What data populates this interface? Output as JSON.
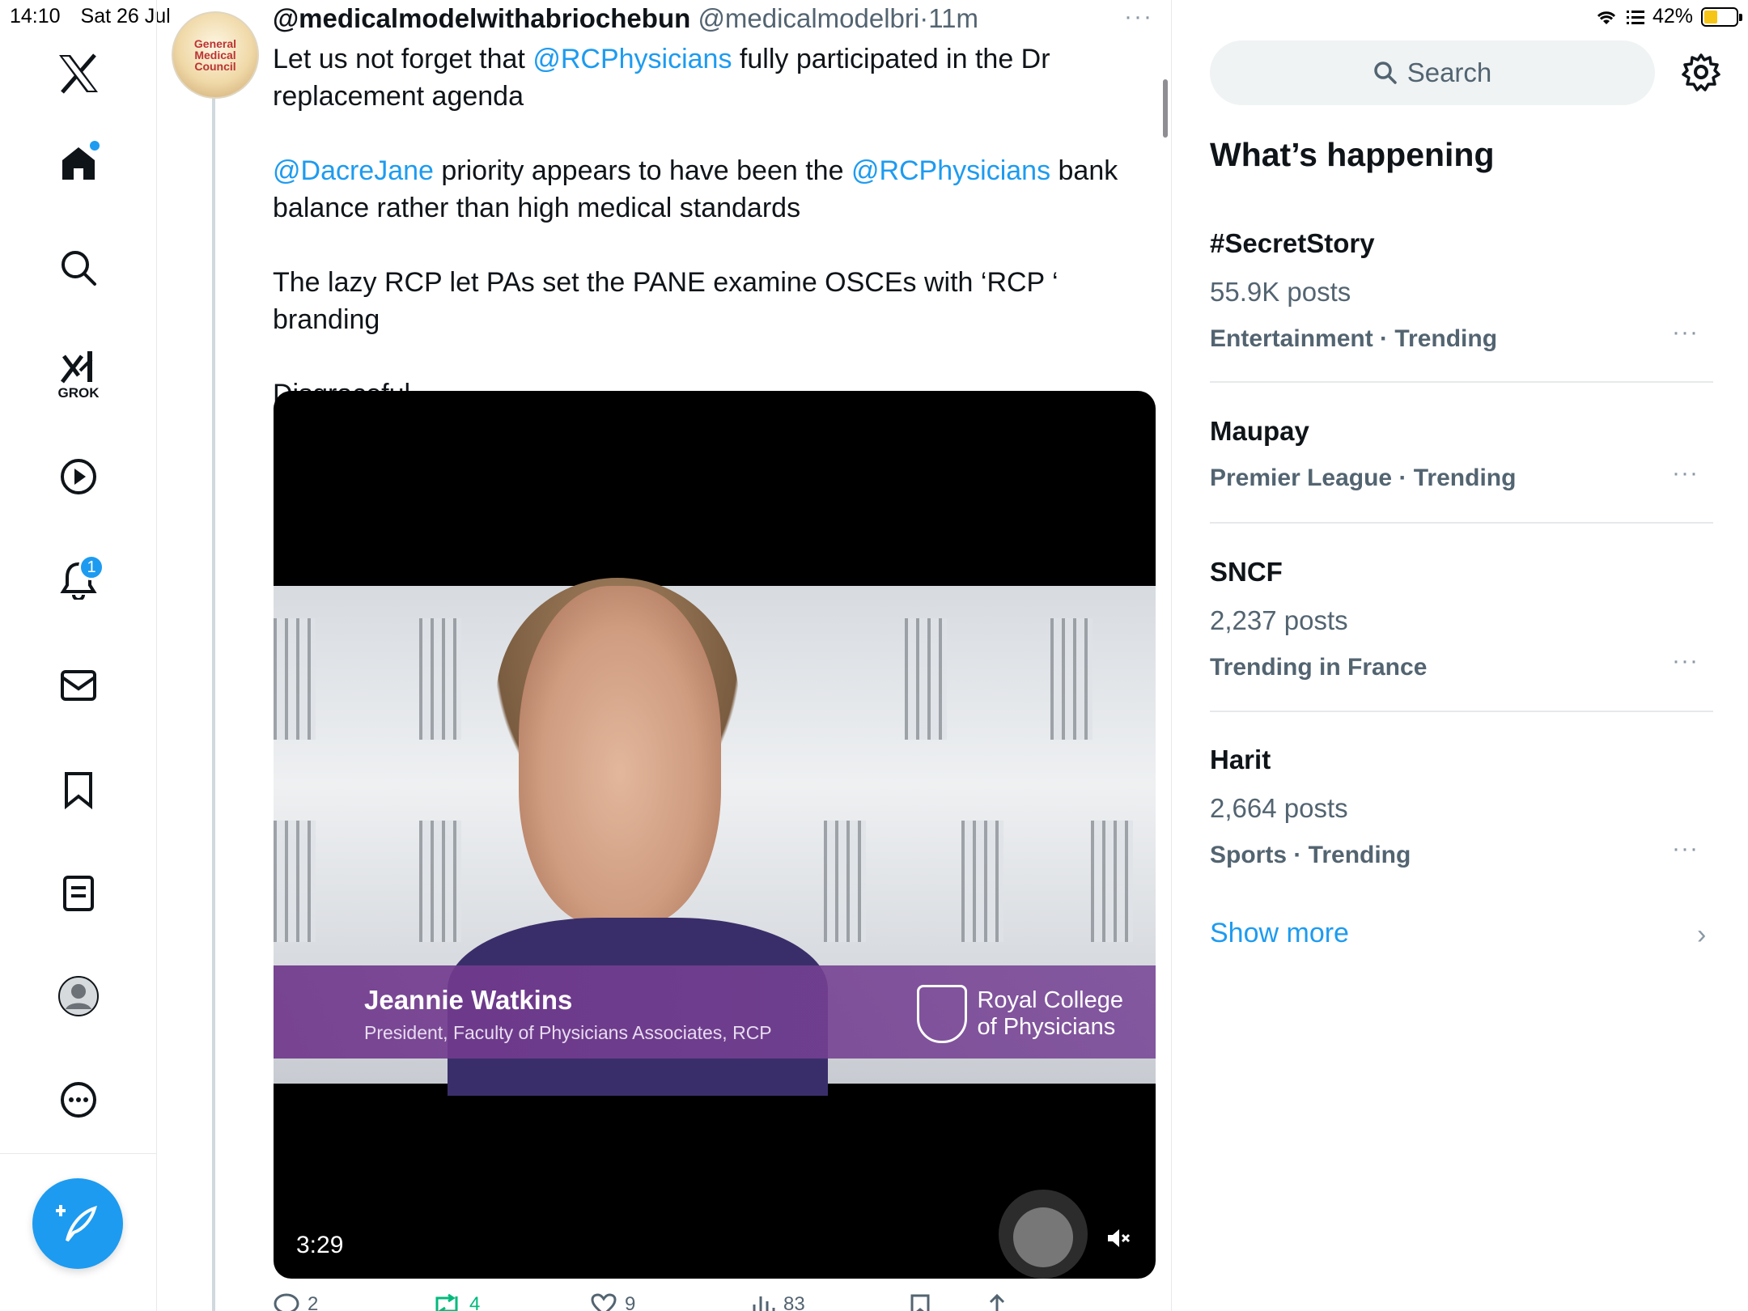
{
  "status_bar": {
    "time": "14:10",
    "date": "Sat 26 Jul",
    "battery": "42%",
    "battery_level": 0.42
  },
  "nav": {
    "items": [
      {
        "icon": "x-logo-icon"
      },
      {
        "icon": "home-icon"
      },
      {
        "icon": "search-icon"
      },
      {
        "icon": "grok-icon",
        "label": "GROK"
      },
      {
        "icon": "video-play-icon"
      },
      {
        "icon": "bell-icon",
        "badge": "1"
      },
      {
        "icon": "mail-icon"
      },
      {
        "icon": "bookmark-icon"
      },
      {
        "icon": "lists-icon"
      },
      {
        "icon": "profile-icon"
      },
      {
        "icon": "more-circle-icon"
      }
    ],
    "compose_icon": "compose-post-icon"
  },
  "tweet": {
    "display_name": "@medicalmodelwithabriochebun",
    "handle": "@medicalmodelbri",
    "separator": "·",
    "time": "11m",
    "avatar_text": "General Medical Council",
    "p1_a": "Let us not forget that ",
    "p1_mention": "@RCPhysicians",
    "p1_b": " fully participated in the Dr replacement agenda",
    "p2_mention1": "@DacreJane",
    "p2_a": " priority appears to have been the ",
    "p2_mention2": "@RCPhysicians",
    "p2_b": "  bank balance rather than high medical standards",
    "p3": "The lazy RCP let PAs set the PANE examine OSCEs with ‘RCP ‘ branding",
    "p4": "Disgraceful",
    "video": {
      "duration": "3:29",
      "lower_third_name": "Jeannie Watkins",
      "lower_third_role": "President, Faculty of Physicians Associates, RCP",
      "logo_line1": "Royal College",
      "logo_line2": "of Physicians"
    },
    "actions": {
      "replies": "2",
      "reposts": "4",
      "likes": "9",
      "views": "83"
    }
  },
  "sidebar": {
    "search_placeholder": "Search",
    "title": "What’s happening",
    "trends": [
      {
        "name": "#SecretStory",
        "posts": "55.9K posts",
        "category": "Entertainment · Trending"
      },
      {
        "name": "Maupay",
        "posts": "",
        "category": "Premier League · Trending"
      },
      {
        "name": "SNCF",
        "posts": "2,237 posts",
        "category": "Trending in France"
      },
      {
        "name": "Harit",
        "posts": "2,664 posts",
        "category": "Sports · Trending"
      }
    ],
    "show_more": "Show more",
    "more_glyph": "···"
  },
  "colors": {
    "accent": "#1d9bf0",
    "text": "#0f1419",
    "muted": "#536471",
    "lower_third": "#70388c"
  }
}
